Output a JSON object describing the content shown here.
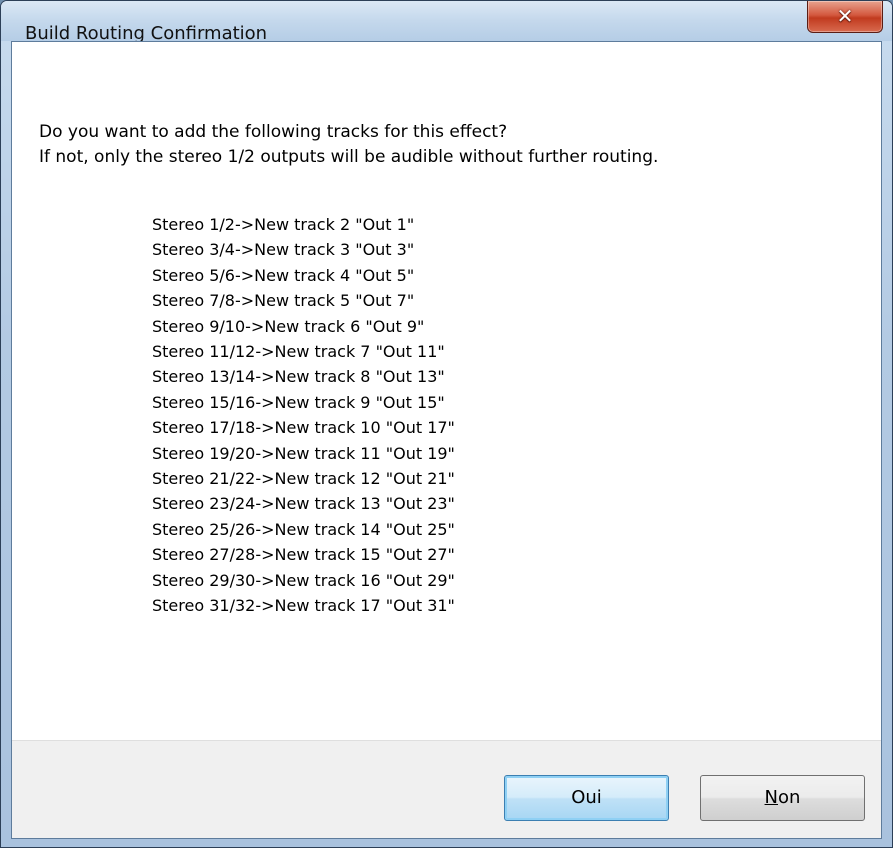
{
  "window": {
    "title": "Build Routing Confirmation",
    "close_glyph": "✕"
  },
  "message": {
    "line1": "Do you want to add the following tracks for this effect?",
    "line2": "If not, only the stereo 1/2 outputs will be audible without further routing."
  },
  "tracks": [
    "Stereo 1/2->New track 2 \"Out 1\"",
    "Stereo 3/4->New track 3 \"Out 3\"",
    "Stereo 5/6->New track 4 \"Out 5\"",
    "Stereo 7/8->New track 5 \"Out 7\"",
    "Stereo 9/10->New track 6 \"Out 9\"",
    "Stereo 11/12->New track 7 \"Out 11\"",
    "Stereo 13/14->New track 8 \"Out 13\"",
    "Stereo 15/16->New track 9 \"Out 15\"",
    "Stereo 17/18->New track 10 \"Out 17\"",
    "Stereo 19/20->New track 11 \"Out 19\"",
    "Stereo 21/22->New track 12 \"Out 21\"",
    "Stereo 23/24->New track 13 \"Out 23\"",
    "Stereo 25/26->New track 14 \"Out 25\"",
    "Stereo 27/28->New track 15 \"Out 27\"",
    "Stereo 29/30->New track 16 \"Out 29\"",
    "Stereo 31/32->New track 17 \"Out 31\""
  ],
  "buttons": {
    "oui": {
      "label": "Oui"
    },
    "non": {
      "accel": "N",
      "rest": "on"
    }
  },
  "colors": {
    "title_bar": "#c4d8ec",
    "close_button": "#c13b1f",
    "dialog_bg": "#ffffff",
    "footer_bg": "#f0f0f0",
    "default_button_border": "#3c7fb1"
  }
}
